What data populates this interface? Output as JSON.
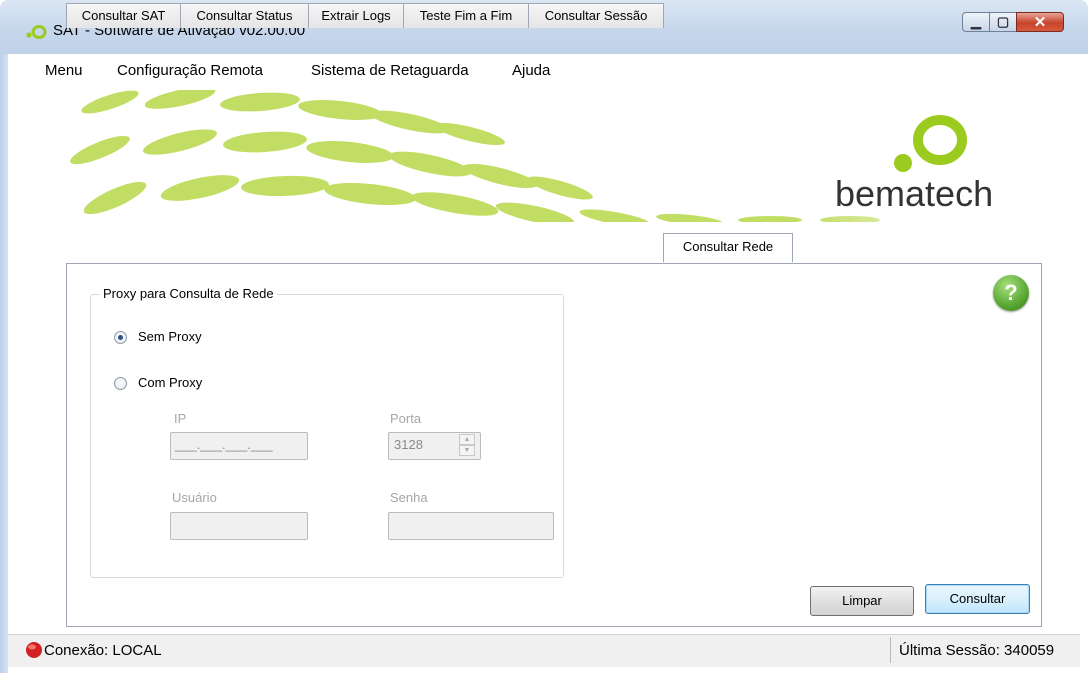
{
  "window": {
    "title": "SAT - Software de Ativação v02.00.00",
    "icon": "sat-logo-icon",
    "controls": {
      "minimize": "minimize-icon",
      "maximize": "maximize-icon",
      "close": "close-icon"
    }
  },
  "menubar": {
    "items": [
      "Menu",
      "Configuração Remota",
      "Sistema de Retaguarda",
      "Ajuda"
    ]
  },
  "banner": {
    "brand": "bematech",
    "accent": "#9ccb1f"
  },
  "tabs": [
    {
      "label": "Consultar SAT",
      "active": false
    },
    {
      "label": "Consultar Status",
      "active": false
    },
    {
      "label": "Extrair Logs",
      "active": false
    },
    {
      "label": "Teste Fim a Fim",
      "active": false
    },
    {
      "label": "Consultar Sessão",
      "active": false
    },
    {
      "label": "Consultar Rede",
      "active": true
    }
  ],
  "proxy_group": {
    "legend": "Proxy para Consulta de Rede",
    "options": [
      {
        "label": "Sem Proxy",
        "checked": true
      },
      {
        "label": "Com Proxy",
        "checked": false
      }
    ],
    "fields": {
      "ip": {
        "label": "IP",
        "value": "___.___.___.___"
      },
      "porta": {
        "label": "Porta",
        "value": "3128"
      },
      "usuario": {
        "label": "Usuário",
        "value": ""
      },
      "senha": {
        "label": "Senha",
        "value": ""
      }
    }
  },
  "help_icon": "?",
  "buttons": {
    "limpar": "Limpar",
    "consultar": "Consultar"
  },
  "statusbar": {
    "connection": "Conexão: LOCAL",
    "connection_color": "#d32020",
    "last_session": "Última Sessão: 340059"
  }
}
